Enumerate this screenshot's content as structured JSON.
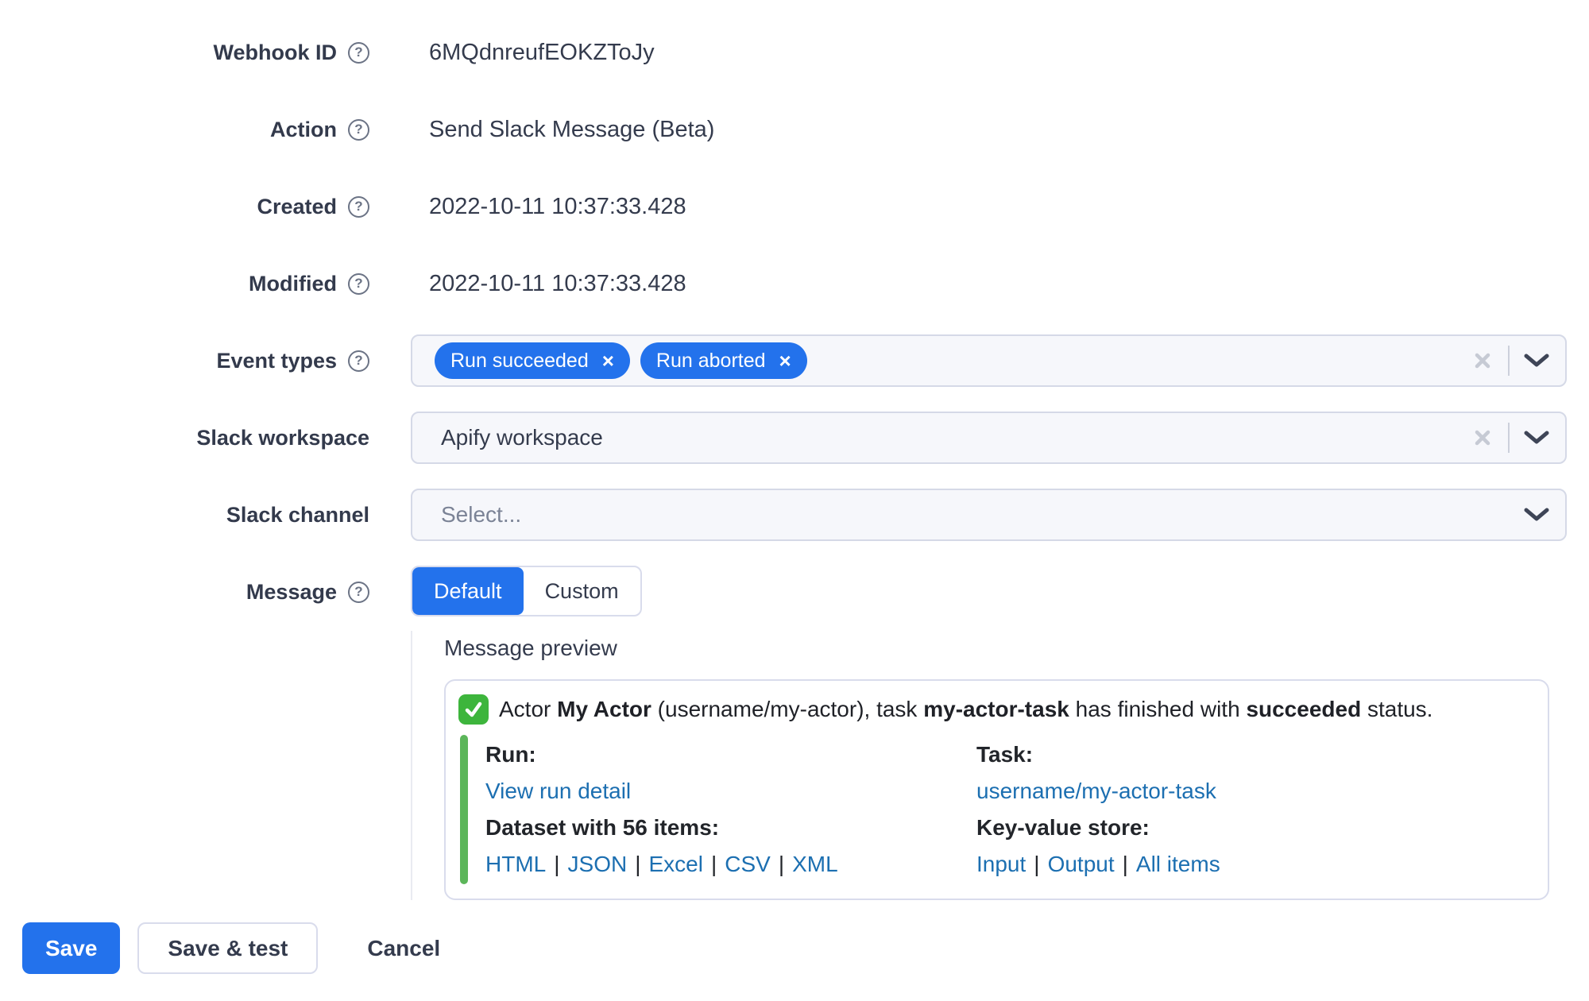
{
  "colors": {
    "primary_blue": "#2372ec",
    "link_blue": "#1c6fb1",
    "attachment_green": "#5cb65a",
    "emoji_green": "#3db53c"
  },
  "icons": {
    "help": "?",
    "tag_remove": "×",
    "clear": "×",
    "chevron": "chevron-down",
    "check_emoji": "white-check-mark"
  },
  "form": {
    "webhook_id": {
      "label": "Webhook ID",
      "value": "6MQdnreufEOKZToJy"
    },
    "action": {
      "label": "Action",
      "value": "Send Slack Message (Beta)"
    },
    "created": {
      "label": "Created",
      "value": "2022-10-11 10:37:33.428"
    },
    "modified": {
      "label": "Modified",
      "value": "2022-10-11 10:37:33.428"
    },
    "event_types": {
      "label": "Event types",
      "tags": [
        {
          "text": "Run succeeded"
        },
        {
          "text": "Run aborted"
        }
      ]
    },
    "slack_workspace": {
      "label": "Slack workspace",
      "value": "Apify workspace"
    },
    "slack_channel": {
      "label": "Slack channel",
      "placeholder": "Select..."
    },
    "message": {
      "label": "Message",
      "options": [
        {
          "label": "Default",
          "selected": true
        },
        {
          "label": "Custom",
          "selected": false
        }
      ]
    }
  },
  "preview": {
    "heading": "Message preview",
    "line": {
      "prefix": "Actor ",
      "actor": "My Actor",
      "mid": " (username/my-actor), task ",
      "task": "my-actor-task",
      "mid2": " has finished with ",
      "status": "succeeded",
      "suffix": " status."
    },
    "separator": "|",
    "run_column": {
      "title": "Run:",
      "link": "View run detail",
      "dataset_title": "Dataset with 56 items:",
      "links": [
        "HTML",
        "JSON",
        "Excel",
        "CSV",
        "XML"
      ]
    },
    "task_column": {
      "title": "Task:",
      "link": "username/my-actor-task",
      "kv_title": "Key-value store:",
      "links": [
        "Input",
        "Output",
        "All items"
      ]
    }
  },
  "footer": {
    "save": "Save",
    "save_and_test": "Save & test",
    "cancel": "Cancel"
  }
}
